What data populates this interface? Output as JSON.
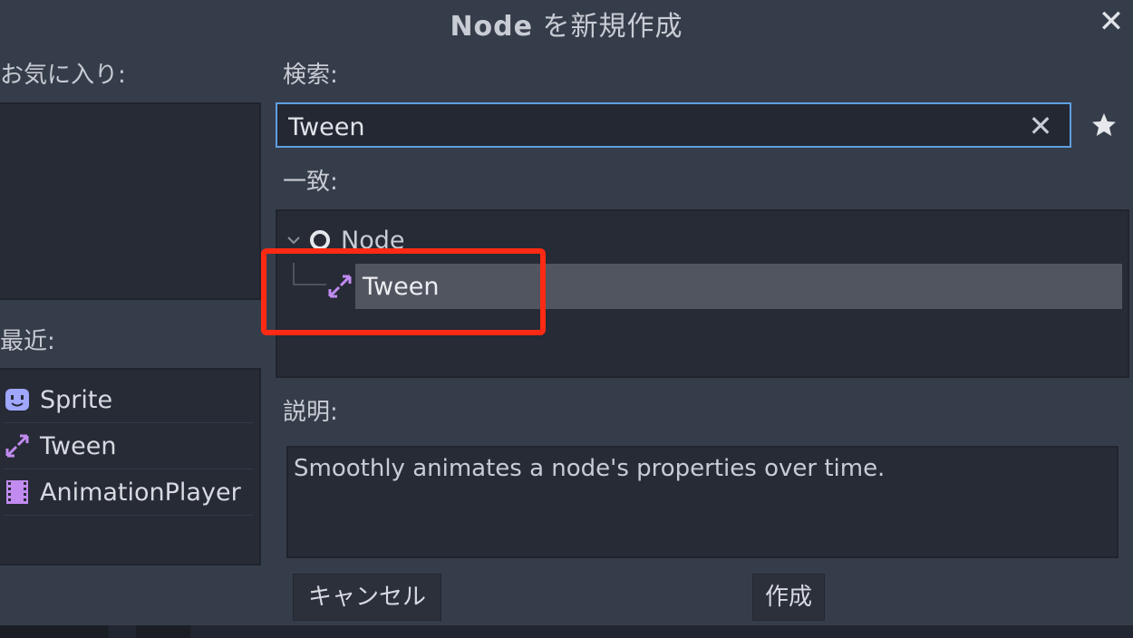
{
  "dialog": {
    "title_node": "Node",
    "title_rest": " を新規作成"
  },
  "favorites": {
    "label": "お気に入り:"
  },
  "search": {
    "label": "検索:",
    "value": "Tween"
  },
  "matches": {
    "label": "一致:",
    "tree": {
      "root": "Node",
      "child": "Tween"
    }
  },
  "recent": {
    "label": "最近:",
    "items": [
      {
        "label": "Sprite",
        "icon": "sprite-icon"
      },
      {
        "label": "Tween",
        "icon": "tween-icon"
      },
      {
        "label": "AnimationPlayer",
        "icon": "animation-player-icon"
      }
    ]
  },
  "description": {
    "label": "説明:",
    "text": "Smoothly animates a node's properties over time."
  },
  "buttons": {
    "cancel": "キャンセル",
    "create": "作成"
  },
  "colors": {
    "accent": "#5f9fe0",
    "highlight": "#ff2a14",
    "node_icon": "#9aa2ff",
    "tween_icon": "#c28bf0"
  }
}
